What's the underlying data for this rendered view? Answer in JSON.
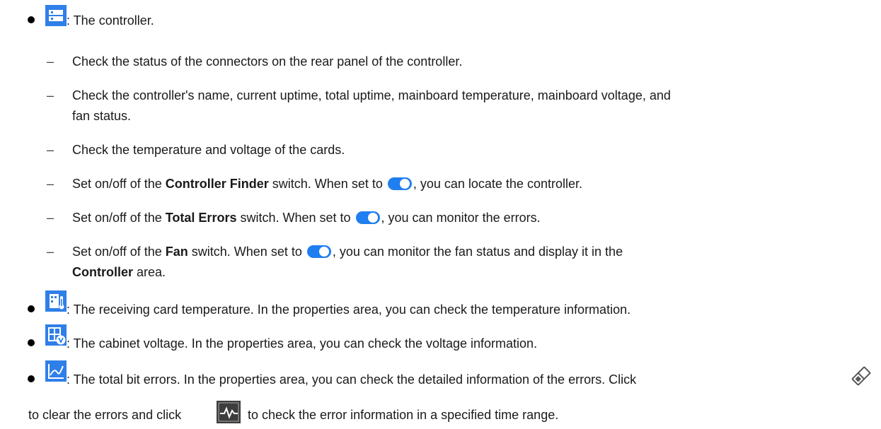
{
  "items": [
    {
      "icon": "controller-icon",
      "text": ": The controller.",
      "subitems": [
        {
          "text": "Check the status of the connectors on the rear panel of the controller."
        },
        {
          "text": "Check the controller's name, current uptime, total uptime, mainboard temperature, mainboard voltage, and",
          "text2": "fan status."
        },
        {
          "text": "Check the temperature and voltage of the cards."
        },
        {
          "pre": "Set on/off of the ",
          "bold": "Controller Finder",
          "mid": " switch. When set to ",
          "post": ", you can locate the controller."
        },
        {
          "pre": "Set on/off of the ",
          "bold": "Total Errors",
          "mid": " switch. When set to ",
          "post": ", you can monitor the errors."
        },
        {
          "pre": "Set on/off of the ",
          "bold": "Fan",
          "mid": " switch. When set to ",
          "post": ", you can monitor the fan status and display it in the",
          "bold2": "Controller",
          "post2": " area."
        }
      ]
    },
    {
      "icon": "receiving-card-temperature-icon",
      "text": ": The receiving card temperature. In the properties area, you can check the temperature information."
    },
    {
      "icon": "cabinet-voltage-icon",
      "text": ": The cabinet voltage. In the properties area, you can check the voltage information."
    },
    {
      "icon": "bit-errors-icon",
      "text": ": The total bit errors. In the properties area, you can check the detailed information of the errors. Click",
      "line2_pre": "to clear the errors and click",
      "line2_post": "to check the error information in a specified time range."
    }
  ],
  "colors": {
    "icon_blue": "#2f7fe8",
    "toggle_blue": "#1f7ef0",
    "text": "#1a1a1a"
  }
}
